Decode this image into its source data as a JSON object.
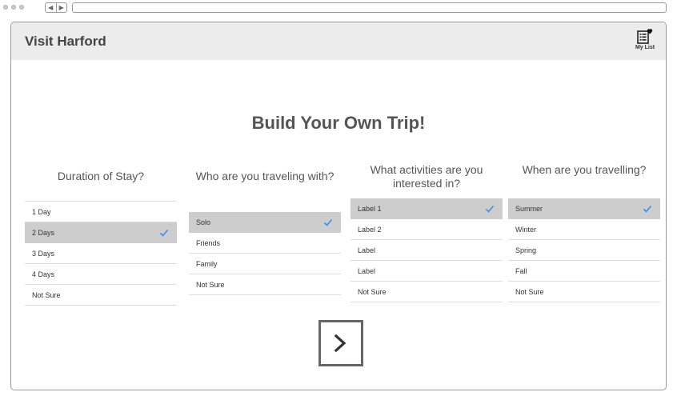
{
  "site": {
    "title": "Visit Harford",
    "my_list_label": "My List"
  },
  "page": {
    "title": "Build Your Own Trip!"
  },
  "columns": [
    {
      "heading": "Duration of Stay?",
      "options": [
        {
          "label": "1 Day",
          "selected": false
        },
        {
          "label": "2 Days",
          "selected": true
        },
        {
          "label": "3 Days",
          "selected": false
        },
        {
          "label": "4 Days",
          "selected": false
        },
        {
          "label": "Not Sure",
          "selected": false
        }
      ]
    },
    {
      "heading": "Who are you traveling with?",
      "options": [
        {
          "label": "Solo",
          "selected": true
        },
        {
          "label": "Friends",
          "selected": false
        },
        {
          "label": "Family",
          "selected": false
        },
        {
          "label": "Not Sure",
          "selected": false
        }
      ]
    },
    {
      "heading": "What activities are you interested in?",
      "options": [
        {
          "label": "Label 1",
          "selected": true
        },
        {
          "label": "Label 2",
          "selected": false
        },
        {
          "label": "Label",
          "selected": false
        },
        {
          "label": "Label",
          "selected": false
        },
        {
          "label": "Not Sure",
          "selected": false
        }
      ]
    },
    {
      "heading": "When are you travelling?",
      "options": [
        {
          "label": "Summer",
          "selected": true
        },
        {
          "label": "Winter",
          "selected": false
        },
        {
          "label": "Spring",
          "selected": false
        },
        {
          "label": "Fall",
          "selected": false
        },
        {
          "label": "Not Sure",
          "selected": false
        }
      ]
    }
  ],
  "icons": {
    "check": "checkmark-icon",
    "next": "chevron-right-icon",
    "my_list": "list-heart-icon"
  },
  "colors": {
    "check": "#3b8ee8",
    "selected_bg": "#cdcdcd",
    "header_bg": "#ececec"
  }
}
